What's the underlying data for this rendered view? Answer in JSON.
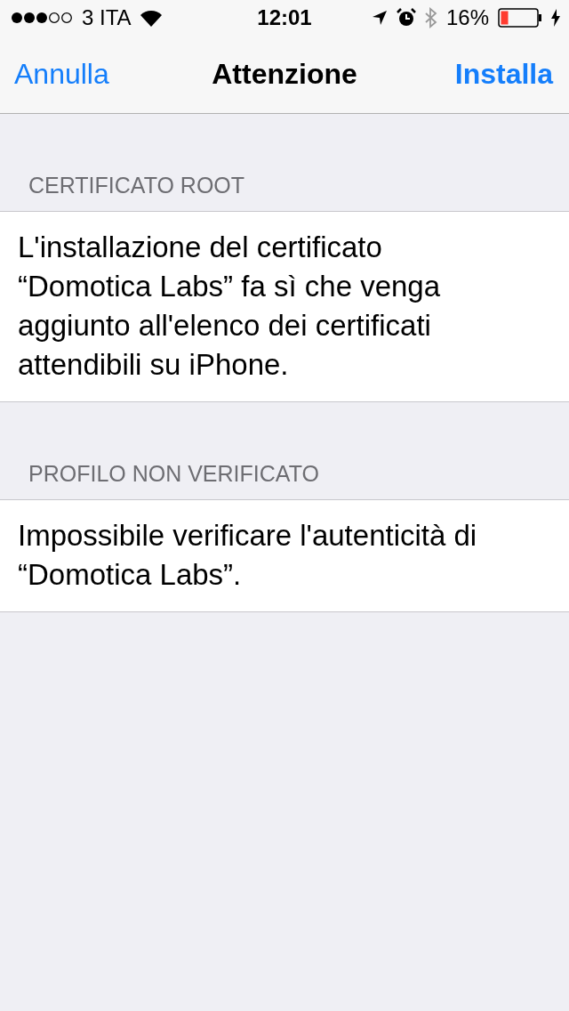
{
  "status_bar": {
    "carrier": "3 ITA",
    "time": "12:01",
    "battery": "16%"
  },
  "nav_bar": {
    "left": "Annulla",
    "title": "Attenzione",
    "right": "Installa"
  },
  "sections": [
    {
      "header": "CERTIFICATO ROOT",
      "text": "L'installazione del certificato “Domotica Labs” fa sì che venga aggiunto all'elenco dei certificati attendibili su iPhone."
    },
    {
      "header": "PROFILO NON VERIFICATO",
      "text": "Impossibile verificare l'autenticità di “Domotica Labs”."
    }
  ]
}
